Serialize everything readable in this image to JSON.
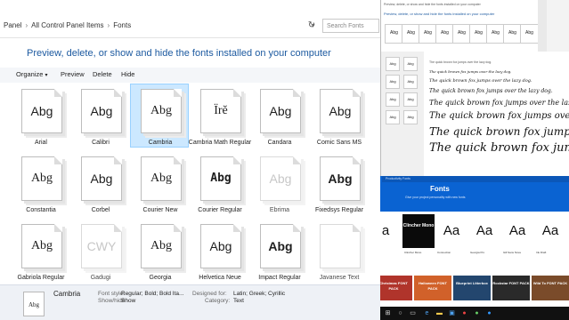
{
  "breadcrumb": {
    "parts": [
      "Panel",
      "All Control Panel Items",
      "Fonts"
    ]
  },
  "search": {
    "placeholder": "Search Fonts"
  },
  "headline": "Preview, delete, or show and hide the fonts installed on your computer",
  "toolbar": {
    "organize": "Organize",
    "preview": "Preview",
    "delete": "Delete",
    "hide": "Hide"
  },
  "fonts": [
    {
      "name": "Arial",
      "sample": "Abg",
      "style": "sans",
      "selected": false,
      "hidden": false
    },
    {
      "name": "Calibri",
      "sample": "Abg",
      "style": "sans",
      "selected": false,
      "hidden": false
    },
    {
      "name": "Cambria",
      "sample": "Abg",
      "style": "serif",
      "selected": true,
      "hidden": false
    },
    {
      "name": "Cambria Math Regular",
      "sample": "Ïrĕ",
      "style": "serif",
      "selected": false,
      "hidden": false
    },
    {
      "name": "Candara",
      "sample": "Abg",
      "style": "sans",
      "selected": false,
      "hidden": false
    },
    {
      "name": "Comic Sans MS",
      "sample": "Abg",
      "style": "sans",
      "selected": false,
      "hidden": false
    },
    {
      "name": "Constantia",
      "sample": "Abg",
      "style": "serif",
      "selected": false,
      "hidden": false
    },
    {
      "name": "Corbel",
      "sample": "Abg",
      "style": "sans",
      "selected": false,
      "hidden": false
    },
    {
      "name": "Courier New",
      "sample": "Abg",
      "style": "serif",
      "selected": false,
      "hidden": false
    },
    {
      "name": "Courier Regular",
      "sample": "Abg",
      "style": "mono",
      "selected": false,
      "hidden": false
    },
    {
      "name": "Ebrima",
      "sample": "Abg",
      "style": "faint",
      "selected": false,
      "hidden": true
    },
    {
      "name": "Fixedsys Regular",
      "sample": "Abg",
      "style": "bold",
      "selected": false,
      "hidden": false
    },
    {
      "name": "Gabriola Regular",
      "sample": "Abg",
      "style": "serif",
      "selected": false,
      "hidden": false
    },
    {
      "name": "Gadugi",
      "sample": "CWY",
      "style": "faint",
      "selected": false,
      "hidden": true
    },
    {
      "name": "Georgia",
      "sample": "Abg",
      "style": "serif",
      "selected": false,
      "hidden": false
    },
    {
      "name": "Helvetica Neue",
      "sample": "Abg",
      "style": "sans",
      "selected": false,
      "hidden": false
    },
    {
      "name": "Impact Regular",
      "sample": "Abg",
      "style": "bold",
      "selected": false,
      "hidden": false
    },
    {
      "name": "Javanese Text",
      "sample": "",
      "style": "faint",
      "selected": false,
      "hidden": true
    }
  ],
  "details": {
    "icon_text": "Abg",
    "name": "Cambria",
    "font_style_label": "Font style:",
    "font_style": "Regular; Bold; Bold Ita...",
    "show_hide_label": "Show/hide:",
    "show_hide": "Show",
    "designed_for_label": "Designed for:",
    "designed_for": "Latin; Greek; Cyrillic",
    "category_label": "Category:",
    "category": "Text"
  },
  "thumb_top": {
    "title": "Preview, delete, or show and hide the fonts installed on your computer",
    "items": [
      "Abg",
      "Abg",
      "Abg",
      "Abg",
      "Abg",
      "Abg",
      "Abg",
      "Abg",
      "Abg"
    ]
  },
  "thumb_preview": {
    "sample_text": "The quick brown fox jumps over the lazy dog.",
    "lines": [
      "The quick brown fox jumps over the lazy dog.",
      "The quick brown fox jumps over the lazy dog.",
      "The quick brown fox jumps over the lazy dog.",
      "The quick brown fox jumps over the lazy d",
      "The quick brown fox jumps over the lazy de",
      "The quick brown fox jumps over th",
      "The quick brown fox jumps over"
    ]
  },
  "thumb_store": {
    "tabs": "Productivity  Fonts",
    "title": "Fonts",
    "subtitle": "Give your project personality with new fonts",
    "cards": [
      {
        "sample": "a",
        "label": "",
        "dark": false
      },
      {
        "sample": "Clincher Mono",
        "label": "Clincher Mono",
        "dark": true
      },
      {
        "sample": "Aa",
        "label": "Connection",
        "dark": false
      },
      {
        "sample": "Aa",
        "label": "Georgia Pro",
        "dark": false
      },
      {
        "sample": "Aa",
        "label": "Gill Sans Nova",
        "dark": false
      },
      {
        "sample": "Aa",
        "label": "Ink Draft",
        "dark": false
      }
    ],
    "packs": [
      "Christmas FONT PACK",
      "Halloween FONT PACK",
      "Blueprint Litterbox",
      "Rockstar FONT PACK",
      "Wild To FONT PACK"
    ]
  },
  "colors": {
    "accent": "#1d5aa0",
    "selection": "#cce8ff",
    "store_blue": "#0a63d2"
  }
}
